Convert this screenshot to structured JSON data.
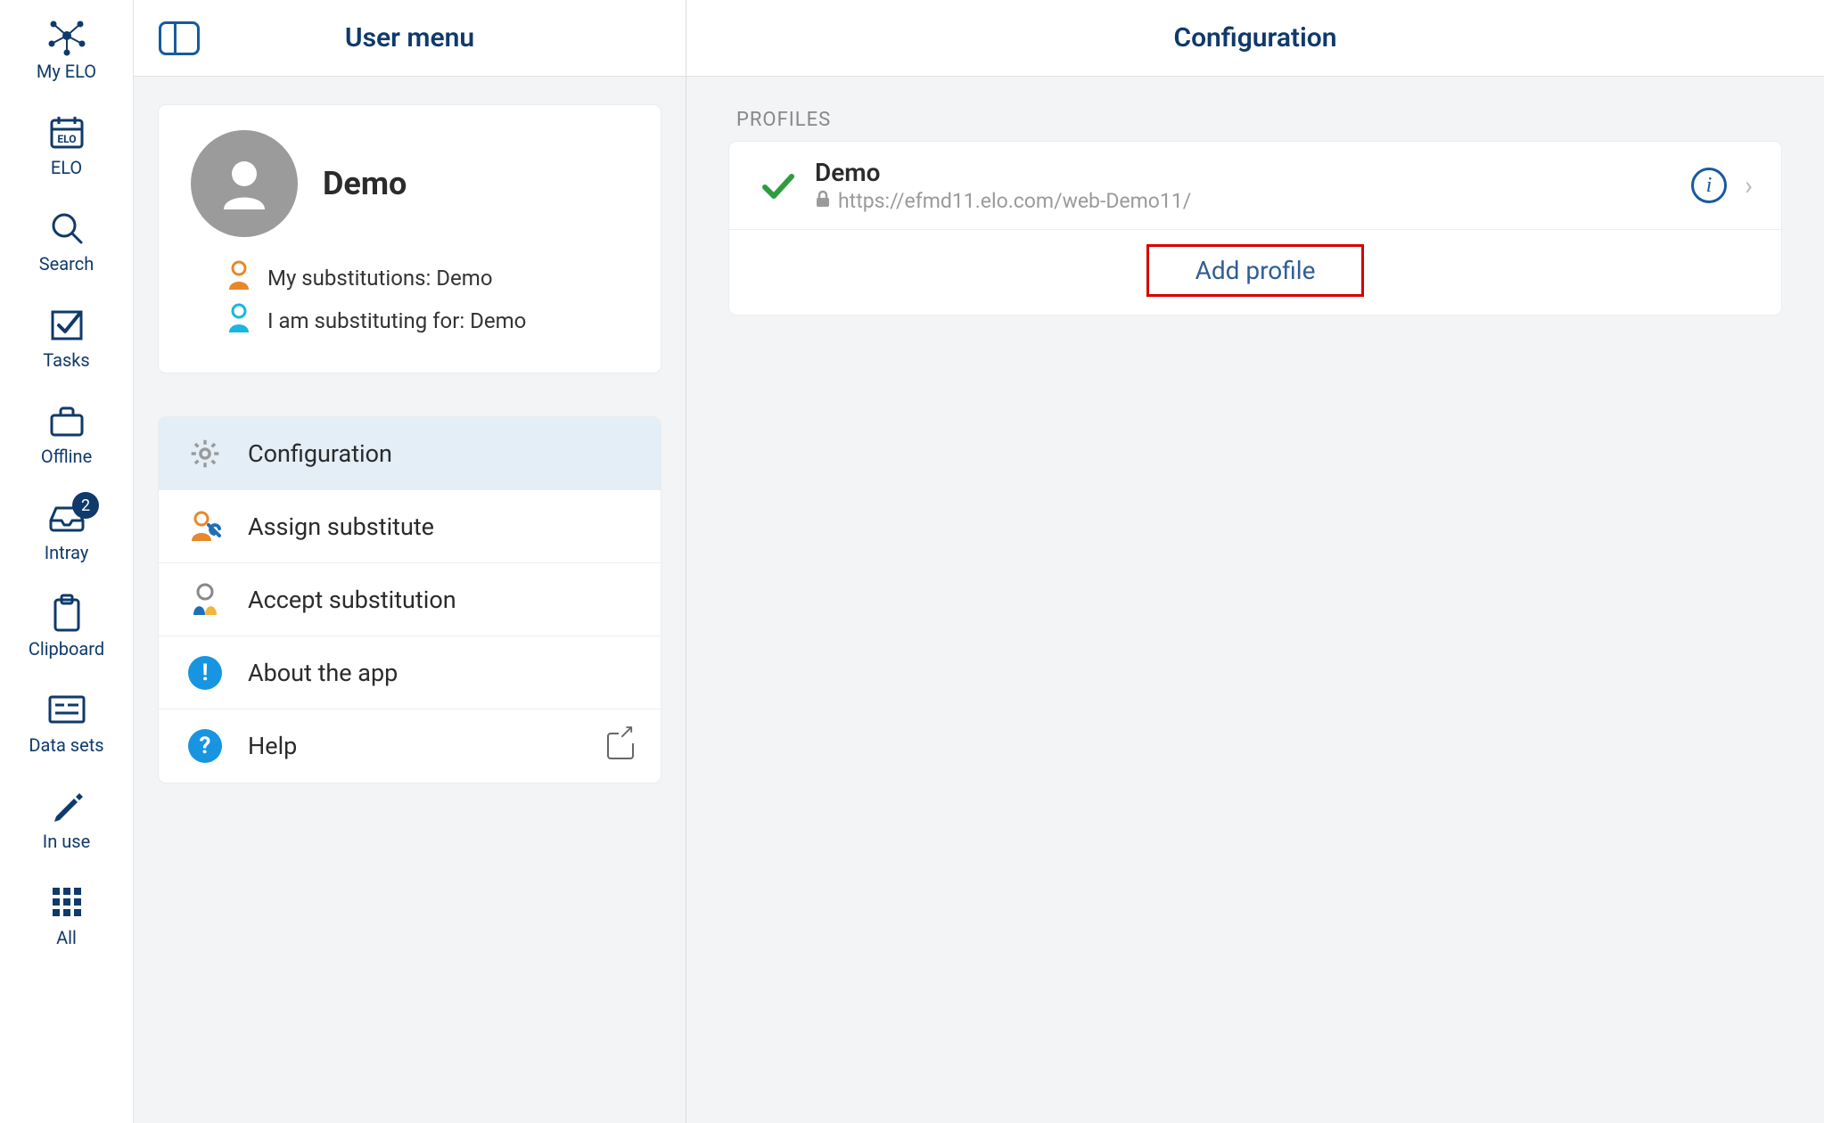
{
  "sidebar": {
    "items": [
      {
        "label": "My ELO"
      },
      {
        "label": "ELO"
      },
      {
        "label": "Search"
      },
      {
        "label": "Tasks"
      },
      {
        "label": "Offline"
      },
      {
        "label": "Intray",
        "badge": "2"
      },
      {
        "label": "Clipboard"
      },
      {
        "label": "Data sets"
      },
      {
        "label": "In use"
      },
      {
        "label": "All"
      }
    ]
  },
  "userMenu": {
    "title": "User menu",
    "username": "Demo",
    "substitutions": {
      "mine": "My substitutions: Demo",
      "for": "I am substituting for: Demo"
    },
    "items": [
      {
        "label": "Configuration",
        "selected": true
      },
      {
        "label": "Assign substitute"
      },
      {
        "label": "Accept substitution"
      },
      {
        "label": "About the app"
      },
      {
        "label": "Help",
        "external": true
      }
    ]
  },
  "config": {
    "title": "Configuration",
    "sectionLabel": "PROFILES",
    "profile": {
      "name": "Demo",
      "url": "https://efmd11.elo.com/web-Demo11/"
    },
    "addLabel": "Add profile"
  }
}
